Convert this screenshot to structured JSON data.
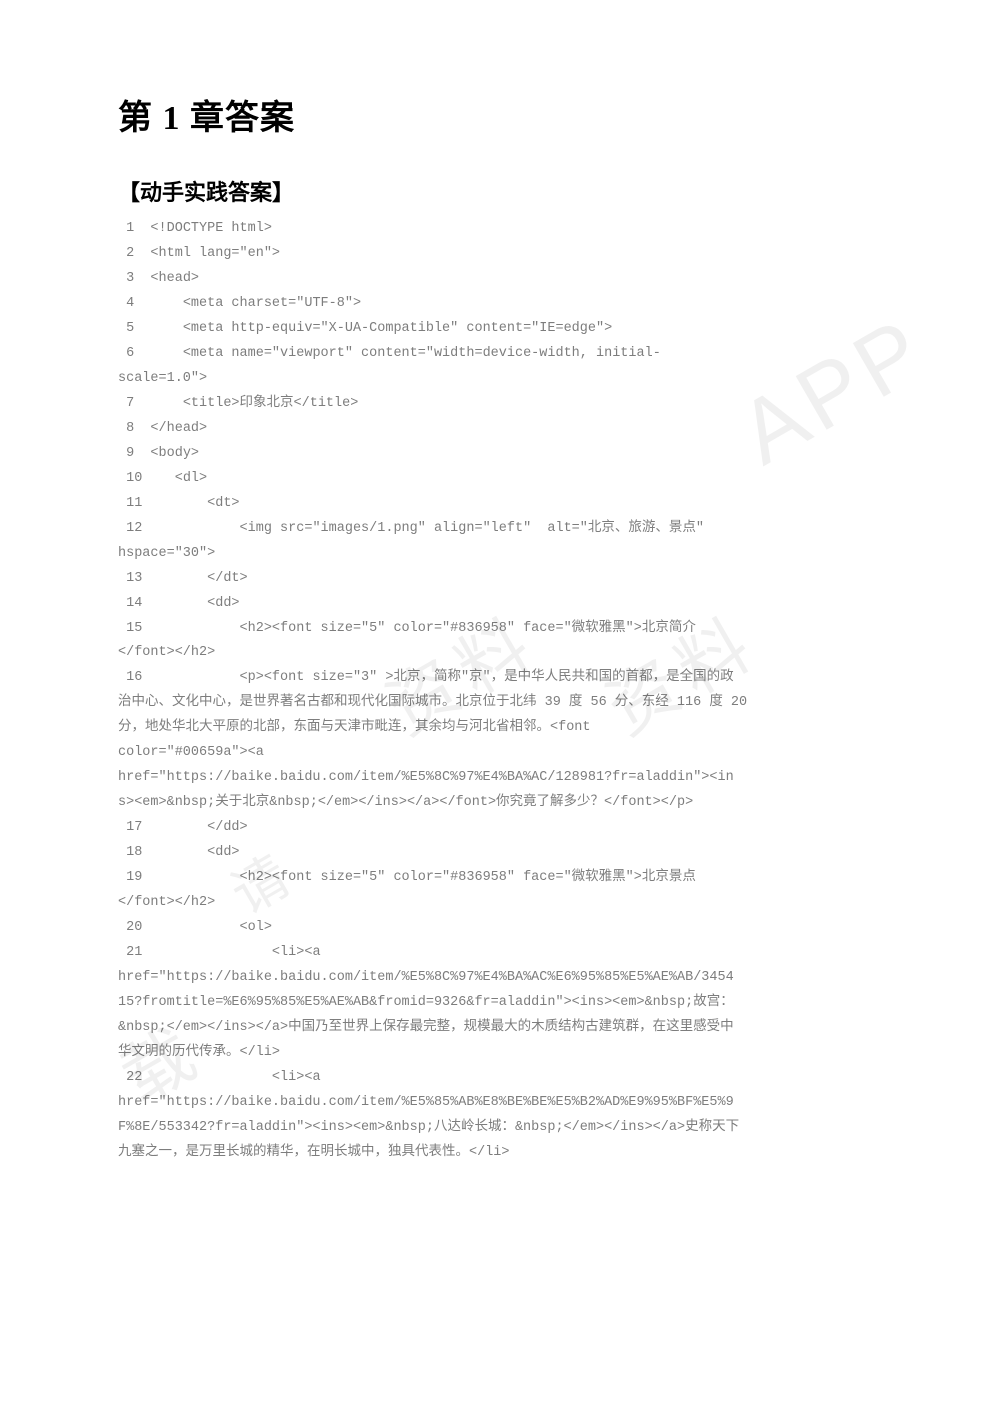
{
  "title": "第 1 章答案",
  "subtitle": "【动手实践答案】",
  "watermarks": {
    "wm1": "APP",
    "wm2": "资料",
    "wm3": "资料",
    "wm4": "请",
    "wm5": "载"
  },
  "lines": [
    " 1  <!DOCTYPE html>",
    " 2  <html lang=\"en\">",
    " 3  <head>",
    " 4      <meta charset=\"UTF-8\">",
    " 5      <meta http-equiv=\"X-UA-Compatible\" content=\"IE=edge\">",
    " 6      <meta name=\"viewport\" content=\"width=device-width, initial-",
    "scale=1.0\">",
    " 7      <title>印象北京</title>",
    " 8  </head>",
    " 9  <body>",
    " 10    <dl>",
    " 11        <dt>",
    " 12            <img src=\"images/1.png\" align=\"left\"  alt=\"北京、旅游、景点\" ",
    "hspace=\"30\">",
    " 13        </dt>",
    " 14        <dd>",
    " 15            <h2><font size=\"5\" color=\"#836958\" face=\"微软雅黑\">北京简介",
    "</font></h2>",
    " 16            <p><font size=\"3\" >北京，简称\"京\"，是中华人民共和国的首都，是全国的政",
    "治中心、文化中心，是世界著名古都和现代化国际城市。北京位于北纬 39 度 56 分、东经 116 度 20 ",
    "分，地处华北大平原的北部，东面与天津市毗连，其余均与河北省相邻。<font ",
    "color=\"#00659a\"><a ",
    "href=\"https://baike.baidu.com/item/%E5%8C%97%E4%BA%AC/128981?fr=aladdin\"><in",
    "s><em>&nbsp;关于北京&nbsp;</em></ins></a></font>你究竟了解多少？</font></p>",
    " 17        </dd>",
    " 18        <dd>",
    " 19            <h2><font size=\"5\" color=\"#836958\" face=\"微软雅黑\">北京景点",
    "</font></h2>",
    " 20            <ol>",
    " 21                <li><a ",
    "href=\"https://baike.baidu.com/item/%E5%8C%97%E4%BA%AC%E6%95%85%E5%AE%AB/3454",
    "15?fromtitle=%E6%95%85%E5%AE%AB&fromid=9326&fr=aladdin\"><ins><em>&nbsp;故宫：",
    "&nbsp;</em></ins></a>中国乃至世界上保存最完整，规模最大的木质结构古建筑群，在这里感受中",
    "华文明的历代传承。</li>",
    " 22                <li><a ",
    "href=\"https://baike.baidu.com/item/%E5%85%AB%E8%BE%BE%E5%B2%AD%E9%95%BF%E5%9",
    "F%8E/553342?fr=aladdin\"><ins><em>&nbsp;八达岭长城：&nbsp;</em></ins></a>史称天下",
    "九塞之一，是万里长城的精华，在明长城中，独具代表性。</li>"
  ]
}
